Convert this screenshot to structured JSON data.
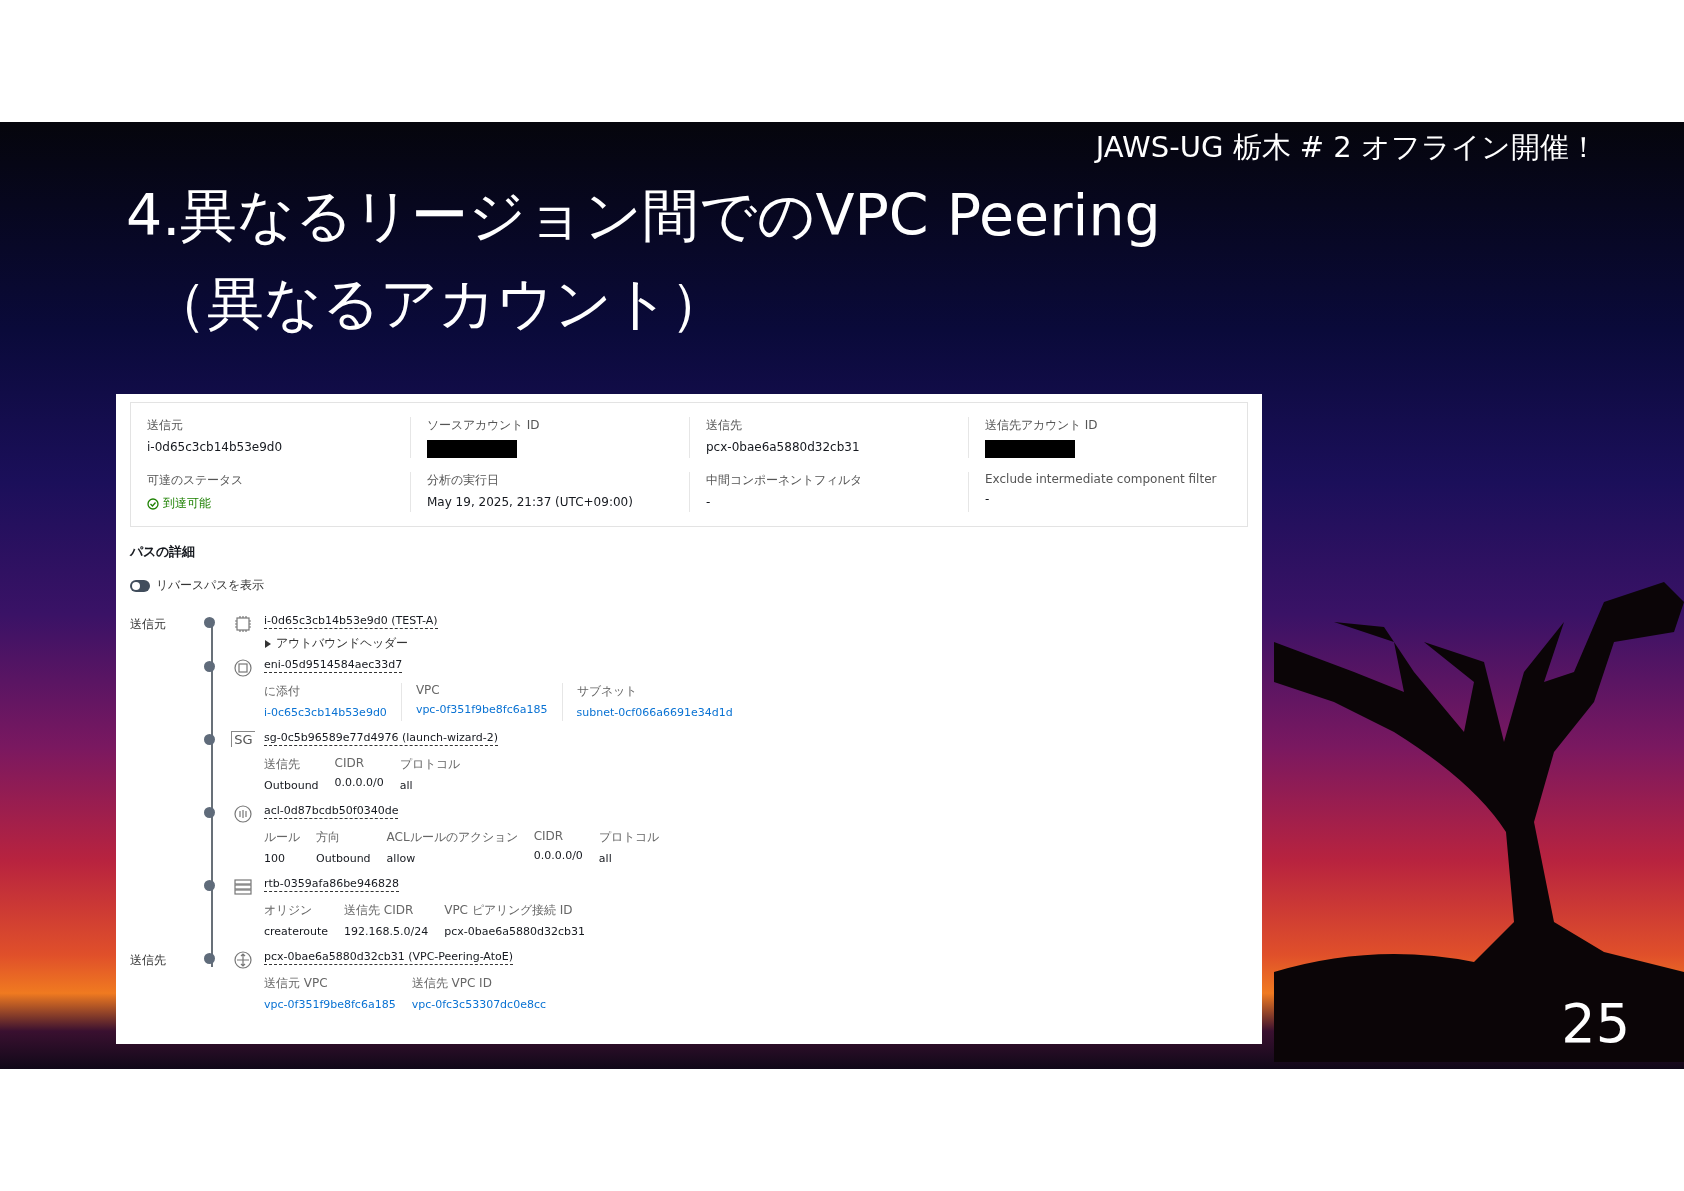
{
  "slide": {
    "header": "JAWS-UG 栃木 # 2 オフライン開催！",
    "title_lines": [
      "4.異なるリージョン間でのVPC Peering",
      "（異なるアカウント）"
    ],
    "page_number": "25"
  },
  "summary": {
    "fields": [
      {
        "kind": "text",
        "label": "送信元",
        "value": "i-0d65c3cb14b53e9d0"
      },
      {
        "kind": "redacted",
        "label": "ソースアカウント ID"
      },
      {
        "kind": "text",
        "label": "送信先",
        "value": "pcx-0bae6a5880d32cb31"
      },
      {
        "kind": "redacted",
        "label": "送信先アカウント ID"
      },
      {
        "kind": "status",
        "label": "可達のステータス",
        "value": "到達可能"
      },
      {
        "kind": "text",
        "label": "分析の実行日",
        "value": "May 19, 2025, 21:37 (UTC+09:00)"
      },
      {
        "kind": "text",
        "label": "中間コンポーネントフィルタ",
        "value": "-"
      },
      {
        "kind": "text",
        "label": "Exclude intermediate component filter",
        "value": "-"
      }
    ]
  },
  "path_details": {
    "heading": "パスの詳細",
    "toggle": {
      "label": "リバースパスを表示",
      "on": false
    },
    "steps": [
      {
        "side_label": "送信元",
        "kind": "instance",
        "title": "i-0d65c3cb14b53e9d0 (TEST-A)",
        "expander": {
          "label": "アウトバウンドヘッダー",
          "expanded": false
        }
      },
      {
        "kind": "eni",
        "title": "eni-05d9514584aec33d7",
        "table": {
          "columns": [
            {
              "header": "に添付",
              "value": "i-0c65c3cb14b53e9d0",
              "link": true
            },
            {
              "header": "VPC",
              "value": "vpc-0f351f9be8fc6a185",
              "link": true
            },
            {
              "header": "サブネット",
              "value": "subnet-0cf066a6691e34d1d",
              "link": true
            }
          ]
        }
      },
      {
        "kind": "security-group",
        "icon_label": "SG",
        "title": "sg-0c5b96589e77d4976 (launch-wizard-2)",
        "table": {
          "columns": [
            {
              "header": "送信先",
              "value": "Outbound",
              "link": false
            },
            {
              "header": "CIDR",
              "value": "0.0.0.0/0",
              "link": false
            },
            {
              "header": "プロトコル",
              "value": "all",
              "link": false
            }
          ]
        }
      },
      {
        "kind": "acl",
        "title": "acl-0d87bcdb50f0340de",
        "table": {
          "columns": [
            {
              "header": "ルール",
              "value": "100",
              "link": false
            },
            {
              "header": "方向",
              "value": "Outbound",
              "link": false
            },
            {
              "header": "ACLルールのアクション",
              "value": "allow",
              "link": false
            },
            {
              "header": "CIDR",
              "value": "0.0.0.0/0",
              "link": false
            },
            {
              "header": "プロトコル",
              "value": "all",
              "link": false
            }
          ]
        }
      },
      {
        "kind": "route-table",
        "title": "rtb-0359afa86be946828",
        "table": {
          "columns": [
            {
              "header": "オリジン",
              "value": "createroute",
              "link": false
            },
            {
              "header": "送信先 CIDR",
              "value": "192.168.5.0/24",
              "link": false
            },
            {
              "header": "VPC ピアリング接続 ID",
              "value": "pcx-0bae6a5880d32cb31",
              "link": false
            }
          ]
        }
      },
      {
        "side_label": "送信先",
        "kind": "peering",
        "title": "pcx-0bae6a5880d32cb31 (VPC-Peering-AtoE)",
        "table": {
          "columns": [
            {
              "header": "送信元 VPC",
              "value": "vpc-0f351f9be8fc6a185",
              "link": true
            },
            {
              "header": "送信先 VPC ID",
              "value": "vpc-0fc3c53307dc0e8cc",
              "link": true
            }
          ]
        }
      }
    ]
  }
}
